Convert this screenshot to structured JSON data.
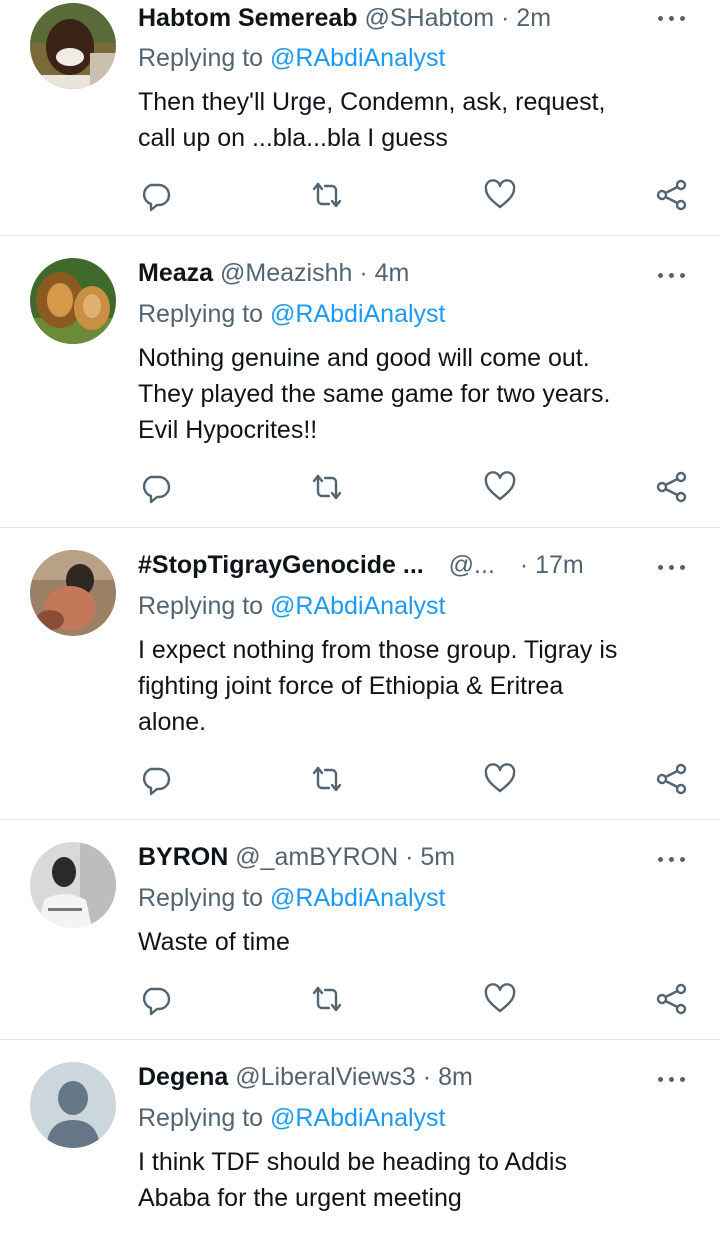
{
  "replying_prefix": "Replying to",
  "tweets": [
    {
      "name": "Habtom Semereab",
      "handle": "@SHabtom",
      "time": "· 2m",
      "reply_to": "@RAbdiAnalyst",
      "lines": [
        "Then they'll Urge, Condemn, ask, request,",
        "call up on ...bla...bla I guess"
      ]
    },
    {
      "name": "Meaza",
      "handle": "@Meazishh",
      "time": "· 4m",
      "reply_to": "@RAbdiAnalyst",
      "lines": [
        "Nothing genuine and good will come out.",
        "They played the same game for two years.",
        "Evil Hypocrites!!"
      ]
    },
    {
      "name": "#StopTigrayGenocide ...",
      "handle": "@...",
      "time": "· 17m",
      "reply_to": "@RAbdiAnalyst",
      "lines": [
        "I expect nothing from those group. Tigray is",
        "fighting joint force of Ethiopia & Eritrea",
        "alone."
      ]
    },
    {
      "name": "BYRON",
      "handle": "@_amBYRON",
      "time": "· 5m",
      "reply_to": "@RAbdiAnalyst",
      "lines": [
        "Waste of time"
      ]
    },
    {
      "name": "Degena",
      "handle": "@LiberalViews3",
      "time": "· 8m",
      "reply_to": "@RAbdiAnalyst",
      "lines": [
        "I think TDF should be heading to Addis",
        "Ababa for the urgent meeting"
      ]
    }
  ],
  "icons": [
    "reply-icon",
    "retweet-icon",
    "like-icon",
    "share-icon",
    "more-icon"
  ],
  "colors": {
    "mention": "#1d9bf0",
    "muted": "#536471",
    "text": "#0f1419"
  }
}
